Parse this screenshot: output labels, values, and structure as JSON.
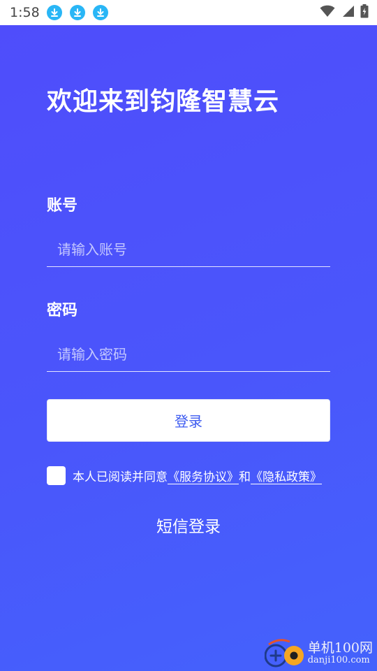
{
  "statusbar": {
    "time": "1:58",
    "notification_icons": [
      "download-icon",
      "download-icon",
      "download-icon"
    ],
    "right_icons": [
      "wifi-icon",
      "signal-icon",
      "battery-charging-icon"
    ]
  },
  "login": {
    "title": "欢迎来到钧隆智慧云",
    "account_label": "账号",
    "account_placeholder": "请输入账号",
    "password_label": "密码",
    "password_placeholder": "请输入密码",
    "login_button": "登录",
    "agreement_prefix": "本人已阅读并同意",
    "service_agreement_link": "《服务协议》",
    "agreement_and": "和",
    "privacy_policy_link": "《隐私政策》",
    "sms_login": "短信登录"
  },
  "watermark": {
    "site_name": "单机100网",
    "site_url": "danji100.com"
  },
  "colors": {
    "background_gradient_start": "#4f4dfb",
    "background_gradient_end": "#4462fc",
    "button_text": "#3d5bf0",
    "notification_icon": "#29b6f6"
  }
}
